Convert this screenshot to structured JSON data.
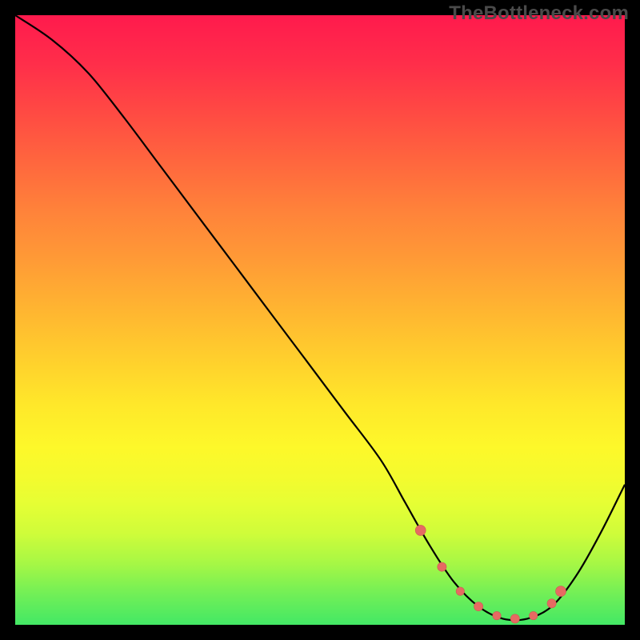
{
  "watermark": "TheBottleneck.com",
  "colors": {
    "page_bg": "#000000",
    "curve_stroke": "#000000",
    "marker_fill": "#e66a62",
    "marker_stroke": "#cc5a54"
  },
  "chart_data": {
    "type": "line",
    "title": "",
    "xlabel": "",
    "ylabel": "",
    "xlim": [
      0,
      100
    ],
    "ylim": [
      0,
      100
    ],
    "grid": false,
    "legend": false,
    "series": [
      {
        "name": "bottleneck-curve",
        "x": [
          0,
          6,
          12,
          18,
          24,
          30,
          36,
          42,
          48,
          54,
          60,
          64,
          68,
          72,
          76,
          80,
          84,
          88,
          92,
          96,
          100
        ],
        "y": [
          100,
          96,
          90.5,
          83,
          75,
          67,
          59,
          51,
          43,
          35,
          27,
          20,
          13,
          7,
          3,
          1,
          1,
          3,
          8,
          15,
          23
        ]
      }
    ],
    "markers": {
      "x": [
        66.5,
        70,
        73,
        76,
        79,
        82,
        85,
        88,
        89.5
      ],
      "y": [
        15.5,
        9.5,
        5.5,
        3,
        1.5,
        1,
        1.5,
        3.5,
        5.5
      ]
    }
  }
}
